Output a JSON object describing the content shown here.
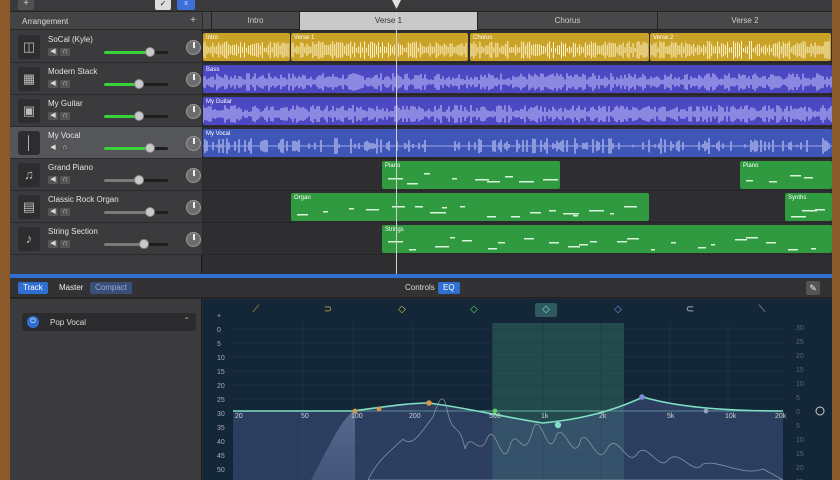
{
  "toolbar": {
    "add_label": "+",
    "pencil_label": "✓",
    "filter_label": "≡"
  },
  "arrangement": {
    "title": "Arrangement",
    "plus": "+"
  },
  "sections": [
    {
      "label": "Intro"
    },
    {
      "label": "Verse 1"
    },
    {
      "label": "Chorus"
    },
    {
      "label": "Verse 2"
    }
  ],
  "tracks": [
    {
      "name": "SoCal (Kyle)",
      "icon": "drums-icon",
      "glyph": "◫",
      "volume": 0.75,
      "active": true
    },
    {
      "name": "Modern Stack",
      "icon": "amp-icon",
      "glyph": "▦",
      "volume": 0.55,
      "active": true
    },
    {
      "name": "My Guitar",
      "icon": "guitar-amp-icon",
      "glyph": "▣",
      "volume": 0.55,
      "active": true
    },
    {
      "name": "My Vocal",
      "icon": "microphone-icon",
      "glyph": "│",
      "volume": 0.75,
      "active": true
    },
    {
      "name": "Grand Piano",
      "icon": "piano-icon",
      "glyph": "♫",
      "volume": 0.55,
      "active": false
    },
    {
      "name": "Classic Rock Organ",
      "icon": "organ-icon",
      "glyph": "▤",
      "volume": 0.75,
      "active": false
    },
    {
      "name": "String Section",
      "icon": "violin-icon",
      "glyph": "♪",
      "volume": 0.65,
      "active": false
    }
  ],
  "regions": {
    "drums": [
      "Intro",
      "Verse 1",
      "Chorus",
      "Verse 2"
    ],
    "bass": "Bass",
    "guitar": "My Guitar",
    "vocal": "My Vocal",
    "piano": [
      "Piano",
      "Piano"
    ],
    "organ": [
      "Organ",
      "Synths"
    ],
    "strings": "Strings"
  },
  "editor": {
    "tabs": [
      "Track",
      "Master",
      "Compact"
    ],
    "controls": "Controls",
    "eq": "EQ",
    "preset": "Pop Vocal"
  },
  "eq": {
    "db_left": [
      "+",
      "0",
      "5",
      "10",
      "15",
      "20",
      "25",
      "30",
      "35",
      "40",
      "45",
      "50"
    ],
    "db_right": [
      "30",
      "25",
      "20",
      "15",
      "10",
      "5",
      "0",
      "5",
      "10",
      "15",
      "20",
      "25"
    ],
    "freqs": [
      "20",
      "50",
      "100",
      "200",
      "500",
      "1k",
      "2k",
      "5k",
      "10k",
      "20k"
    ]
  },
  "colors": {
    "drums": "#c9a227",
    "audio": "#4b48c2",
    "midi": "#2f9a3f",
    "accent": "#2f6fd1"
  }
}
